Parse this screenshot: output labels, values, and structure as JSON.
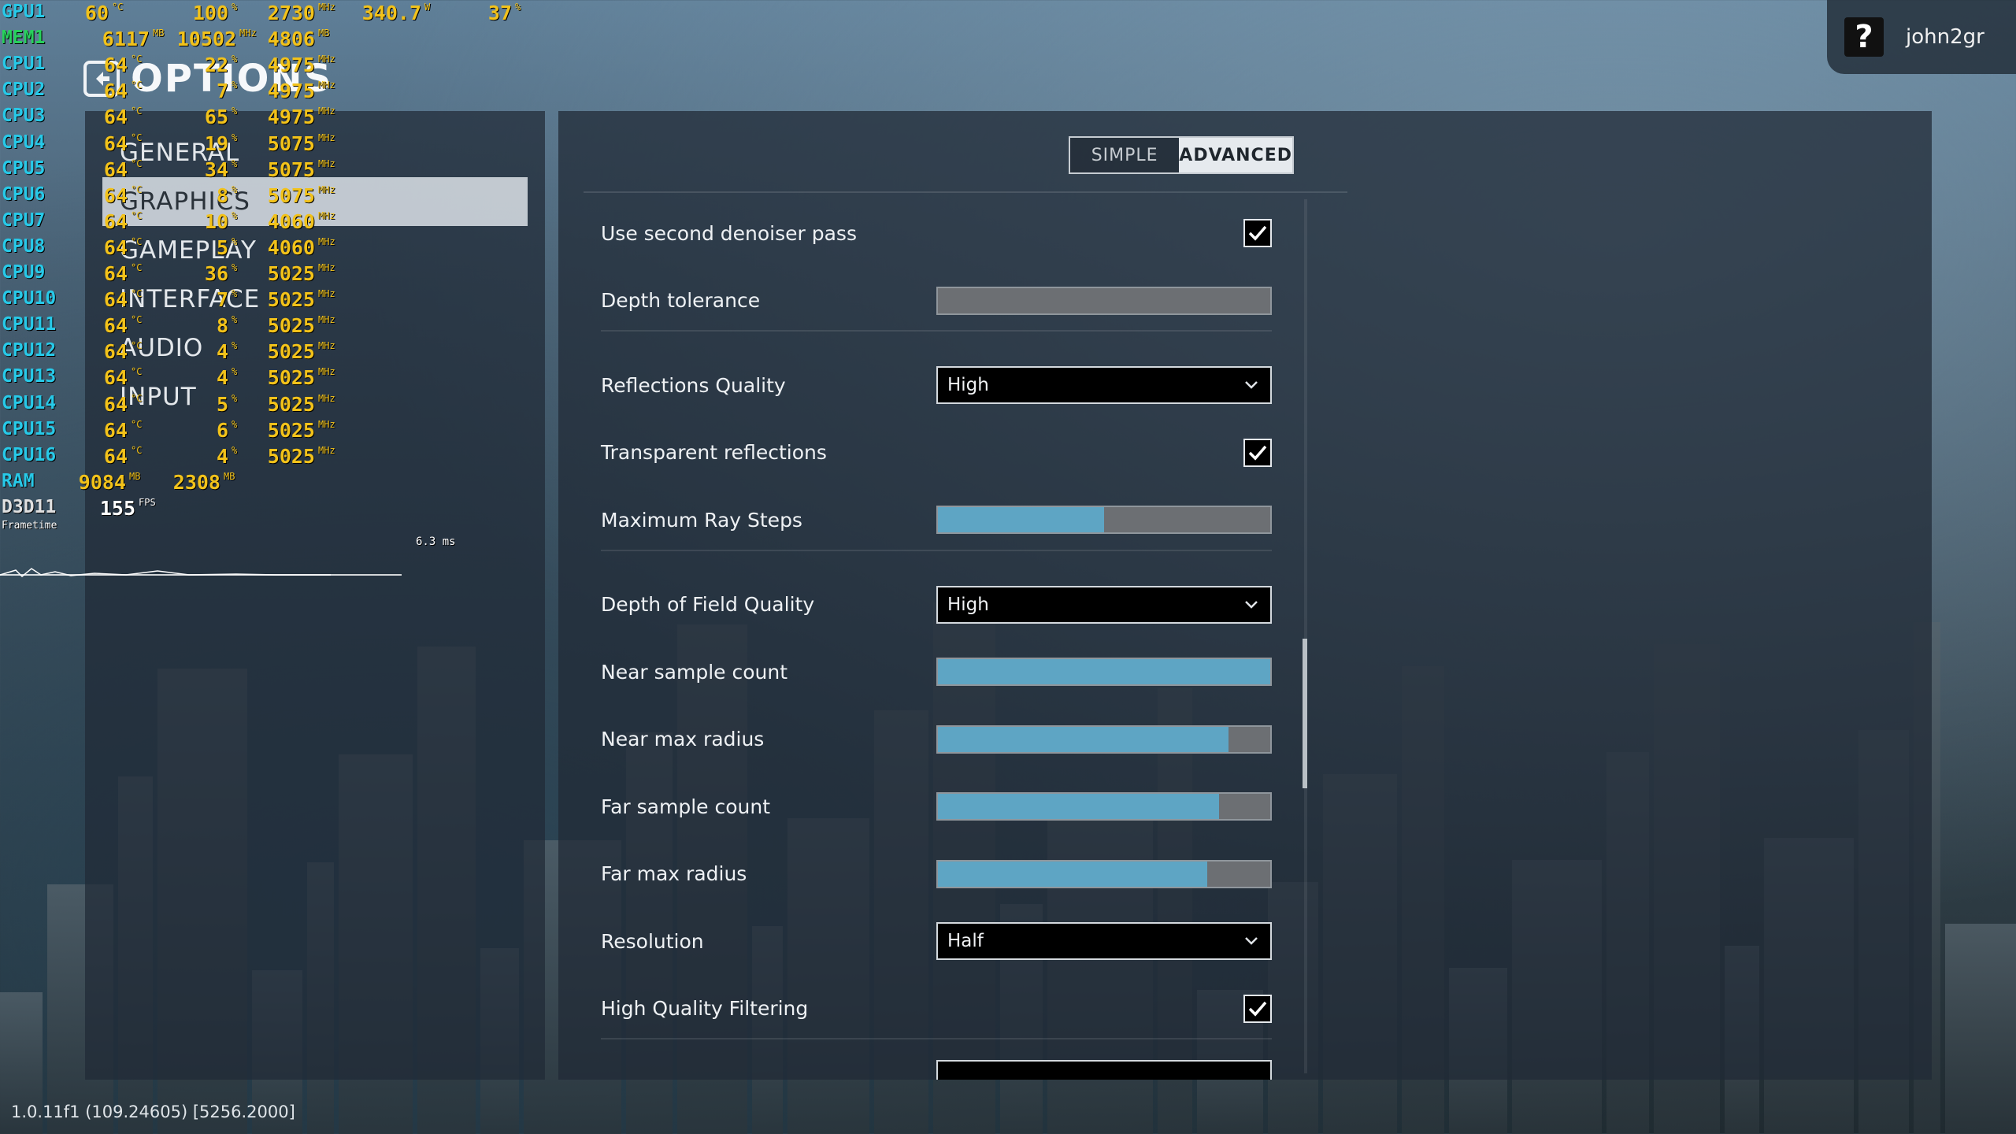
{
  "user": {
    "help_label": "?",
    "name": "john2gr"
  },
  "header": {
    "title": "OPTIONS"
  },
  "nav": {
    "items": [
      "GENERAL",
      "GRAPHICS",
      "GAMEPLAY",
      "INTERFACE",
      "AUDIO",
      "INPUT"
    ],
    "active": "GRAPHICS"
  },
  "mode": {
    "simple": "SIMPLE",
    "advanced": "ADVANCED",
    "selected": "ADVANCED"
  },
  "settings": [
    {
      "type": "checkbox",
      "label": "Use second denoiser pass",
      "checked": true
    },
    {
      "type": "slider",
      "label": "Depth tolerance",
      "value": "0.1",
      "fill": 0.0
    },
    {
      "type": "separator"
    },
    {
      "type": "dropdown",
      "label": "Reflections Quality",
      "value": "High"
    },
    {
      "type": "checkbox",
      "label": "Transparent reflections",
      "checked": true
    },
    {
      "type": "slider",
      "label": "Maximum Ray Steps",
      "value": "64",
      "fill": 0.5
    },
    {
      "type": "separator"
    },
    {
      "type": "dropdown",
      "label": "Depth of Field Quality",
      "value": "High"
    },
    {
      "type": "slider",
      "label": "Near sample count",
      "value": "8",
      "fill": 1.0
    },
    {
      "type": "slider",
      "label": "Near max radius",
      "value": "7",
      "fill": 0.875
    },
    {
      "type": "slider",
      "label": "Far sample count",
      "value": "14",
      "fill": 0.846
    },
    {
      "type": "slider",
      "label": "Far max radius",
      "value": "13",
      "fill": 0.81
    },
    {
      "type": "dropdown",
      "label": "Resolution",
      "value": "Half"
    },
    {
      "type": "checkbox",
      "label": "High Quality Filtering",
      "checked": true
    },
    {
      "type": "separator"
    }
  ],
  "osd": {
    "rows": [
      {
        "label": "GPU1",
        "kind": "gpu",
        "vals": [
          [
            "60",
            "°C"
          ],
          [
            "100",
            "%"
          ],
          [
            "2730",
            "MHz"
          ],
          [
            "340.7",
            "W"
          ],
          [
            "37",
            "%"
          ]
        ]
      },
      {
        "label": "MEM1",
        "kind": "mem",
        "vals": [
          [
            "6117",
            "MB"
          ],
          [
            "10502",
            "MHz"
          ],
          [
            "4806",
            "MB"
          ]
        ]
      },
      {
        "label": "CPU1",
        "kind": "cpu",
        "vals": [
          [
            "64",
            "°C"
          ],
          [
            "22",
            "%"
          ],
          [
            "4975",
            "MHz"
          ]
        ]
      },
      {
        "label": "CPU2",
        "kind": "cpu",
        "vals": [
          [
            "64",
            "°C"
          ],
          [
            "7",
            "%"
          ],
          [
            "4975",
            "MHz"
          ]
        ]
      },
      {
        "label": "CPU3",
        "kind": "cpu",
        "vals": [
          [
            "64",
            "°C"
          ],
          [
            "65",
            "%"
          ],
          [
            "4975",
            "MHz"
          ]
        ]
      },
      {
        "label": "CPU4",
        "kind": "cpu",
        "vals": [
          [
            "64",
            "°C"
          ],
          [
            "19",
            "%"
          ],
          [
            "5075",
            "MHz"
          ]
        ]
      },
      {
        "label": "CPU5",
        "kind": "cpu",
        "vals": [
          [
            "64",
            "°C"
          ],
          [
            "34",
            "%"
          ],
          [
            "5075",
            "MHz"
          ]
        ]
      },
      {
        "label": "CPU6",
        "kind": "cpu",
        "vals": [
          [
            "64",
            "°C"
          ],
          [
            "8",
            "%"
          ],
          [
            "5075",
            "MHz"
          ]
        ]
      },
      {
        "label": "CPU7",
        "kind": "cpu",
        "vals": [
          [
            "64",
            "°C"
          ],
          [
            "10",
            "%"
          ],
          [
            "4060",
            "MHz"
          ]
        ]
      },
      {
        "label": "CPU8",
        "kind": "cpu",
        "vals": [
          [
            "64",
            "°C"
          ],
          [
            "5",
            "%"
          ],
          [
            "4060",
            "MHz"
          ]
        ]
      },
      {
        "label": "CPU9",
        "kind": "cpu",
        "vals": [
          [
            "64",
            "°C"
          ],
          [
            "36",
            "%"
          ],
          [
            "5025",
            "MHz"
          ]
        ]
      },
      {
        "label": "CPU10",
        "kind": "cpu",
        "vals": [
          [
            "64",
            "°C"
          ],
          [
            "7",
            "%"
          ],
          [
            "5025",
            "MHz"
          ]
        ]
      },
      {
        "label": "CPU11",
        "kind": "cpu",
        "vals": [
          [
            "64",
            "°C"
          ],
          [
            "8",
            "%"
          ],
          [
            "5025",
            "MHz"
          ]
        ]
      },
      {
        "label": "CPU12",
        "kind": "cpu",
        "vals": [
          [
            "64",
            "°C"
          ],
          [
            "4",
            "%"
          ],
          [
            "5025",
            "MHz"
          ]
        ]
      },
      {
        "label": "CPU13",
        "kind": "cpu",
        "vals": [
          [
            "64",
            "°C"
          ],
          [
            "4",
            "%"
          ],
          [
            "5025",
            "MHz"
          ]
        ]
      },
      {
        "label": "CPU14",
        "kind": "cpu",
        "vals": [
          [
            "64",
            "°C"
          ],
          [
            "5",
            "%"
          ],
          [
            "5025",
            "MHz"
          ]
        ]
      },
      {
        "label": "CPU15",
        "kind": "cpu",
        "vals": [
          [
            "64",
            "°C"
          ],
          [
            "6",
            "%"
          ],
          [
            "5025",
            "MHz"
          ]
        ]
      },
      {
        "label": "CPU16",
        "kind": "cpu",
        "vals": [
          [
            "64",
            "°C"
          ],
          [
            "4",
            "%"
          ],
          [
            "5025",
            "MHz"
          ]
        ]
      },
      {
        "label": "RAM",
        "kind": "ram",
        "vals": [
          [
            "9084",
            "MB"
          ],
          [
            "2308",
            "MB"
          ]
        ]
      },
      {
        "label": "D3D11",
        "kind": "d3d",
        "vals": [
          [
            "155",
            "FPS"
          ]
        ]
      }
    ],
    "frametime_label": "Frametime",
    "frametime_ms": "6.3 ms"
  },
  "footer": {
    "version": "1.0.11f1 (109.24605) [5256.2000]"
  },
  "colors": {
    "accent": "#5ea5c4",
    "osd_value": "#f2c21a",
    "osd_label": "#27c9e8"
  }
}
